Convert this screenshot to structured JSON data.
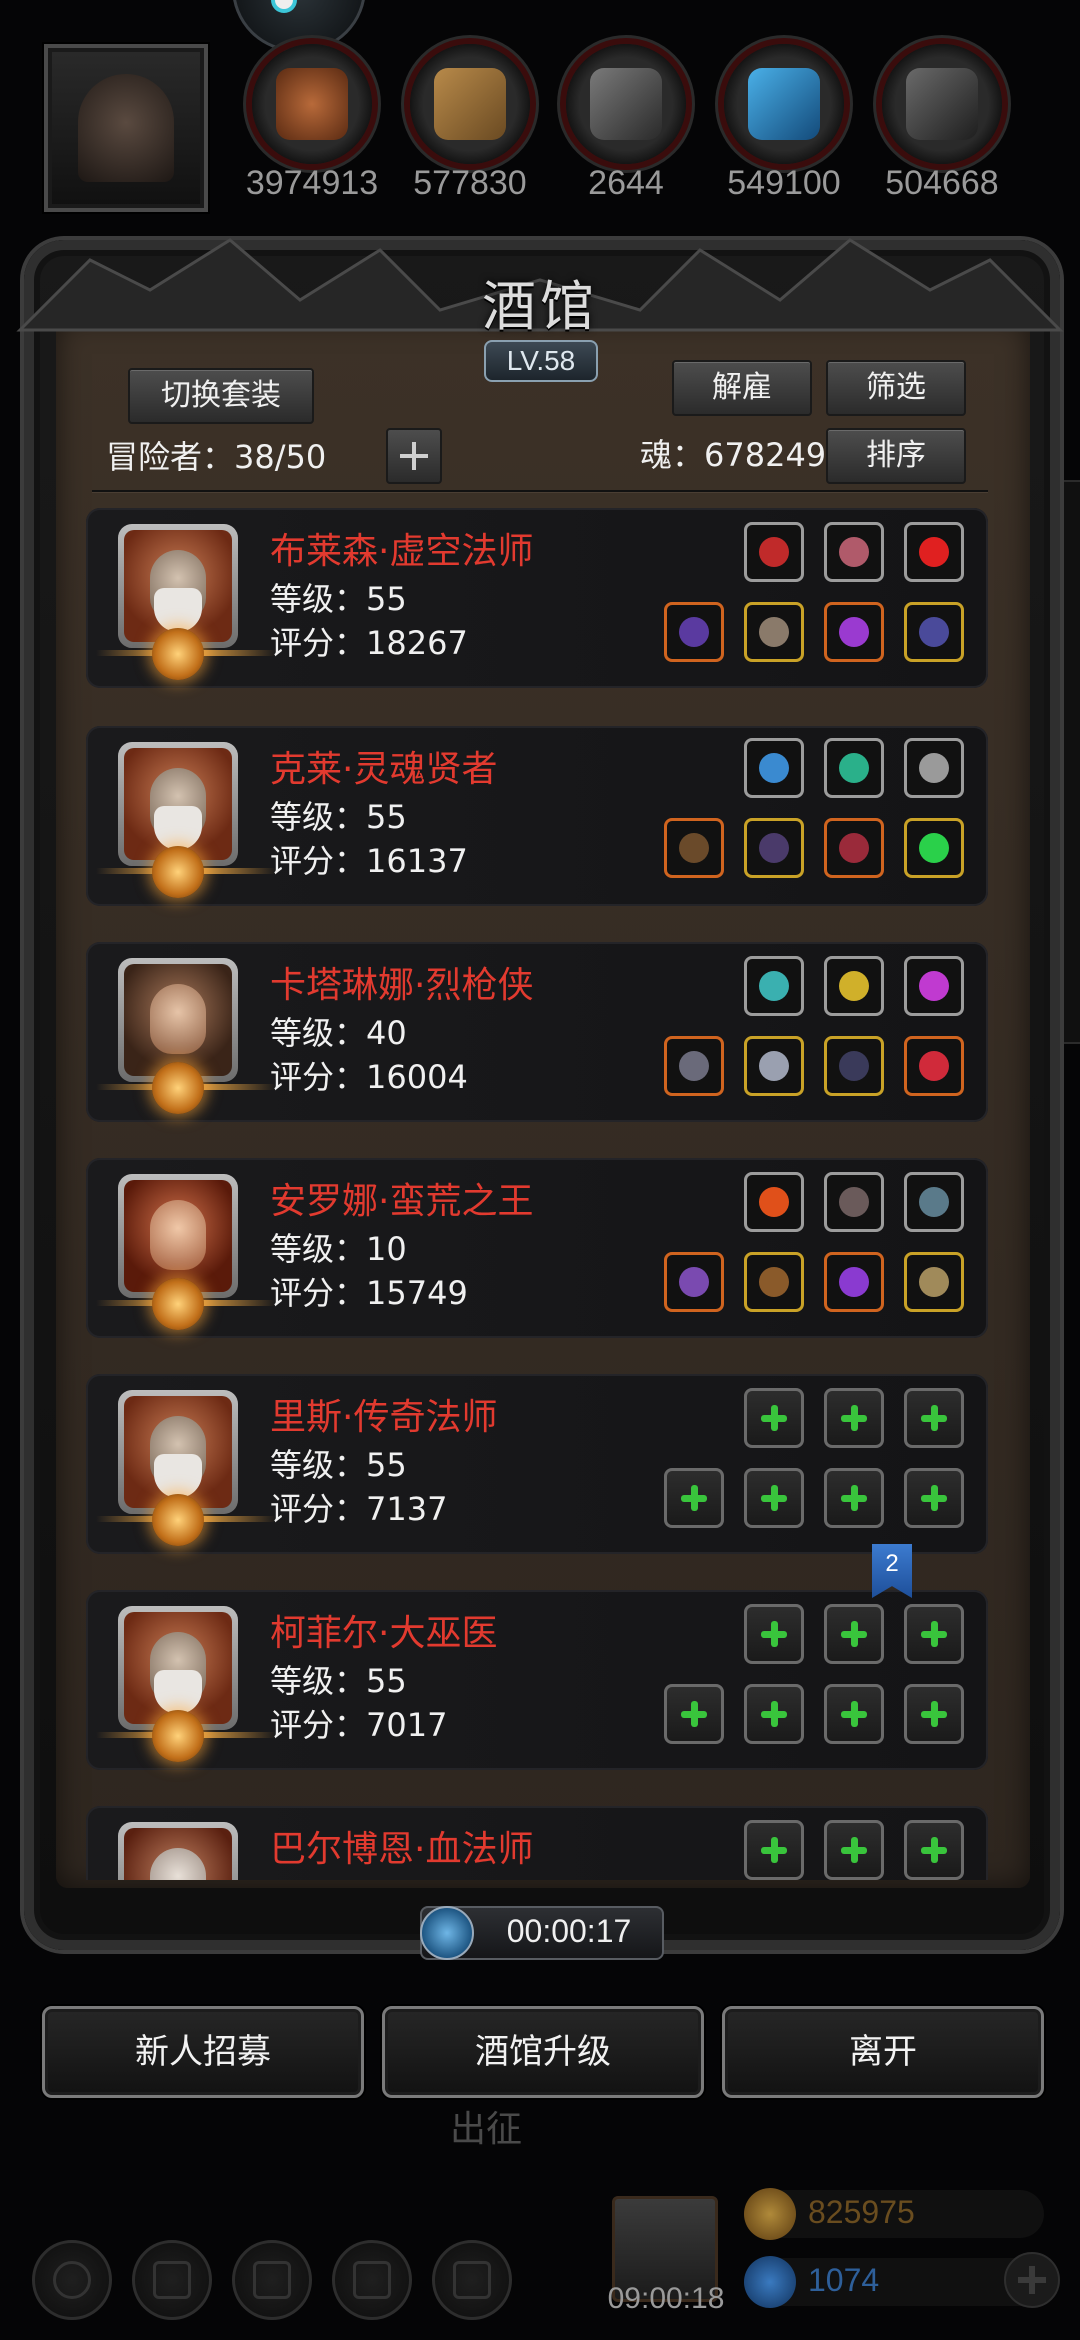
{
  "resources": [
    {
      "icon": "meat-icon",
      "value": "3974913",
      "color": "#8a4a2a"
    },
    {
      "icon": "wood-icon",
      "value": "577830",
      "color": "#8a6a3a"
    },
    {
      "icon": "iron-icon",
      "value": "2644",
      "color": "#5a5a5a"
    },
    {
      "icon": "crystal-icon",
      "value": "549100",
      "color": "#2a7ab0"
    },
    {
      "icon": "stone-icon",
      "value": "504668",
      "color": "#4a4a4a"
    }
  ],
  "tavern": {
    "title": "酒馆",
    "level": "LV.58",
    "switch_outfit": "切换套装",
    "dismiss": "解雇",
    "filter": "筛选",
    "sort": "排序",
    "adventurers": "冒险者：38/50",
    "soul": "魂：678249"
  },
  "heroes": [
    {
      "name": "布莱森·虚空法师",
      "level": "等级：55",
      "score": "评分：18267"
    },
    {
      "name": "克莱·灵魂贤者",
      "level": "等级：55",
      "score": "评分：16137"
    },
    {
      "name": "卡塔琳娜·烈枪侠",
      "level": "等级：40",
      "score": "评分：16004"
    },
    {
      "name": "安罗娜·蛮荒之王",
      "level": "等级：10",
      "score": "评分：15749"
    },
    {
      "name": "里斯·传奇法师",
      "level": "等级：55",
      "score": "评分：7137"
    },
    {
      "name": "柯菲尔·大巫医",
      "level": "等级：55",
      "score": "评分：7017"
    },
    {
      "name": "巴尔博恩·血法师",
      "level": "",
      "score": ""
    }
  ],
  "badge_count": "2",
  "timer": "00:00:17",
  "buttons": {
    "recruit": "新人招募",
    "upgrade": "酒馆升级",
    "leave": "离开"
  },
  "ghost_label": "出征",
  "gift_timer": "09:00:18",
  "gold": "825975",
  "gems": "1074",
  "colors": {
    "hero_name": "#e23a2f",
    "gold_text": "#6a4d1f",
    "gem_text": "#2e5f9a"
  }
}
